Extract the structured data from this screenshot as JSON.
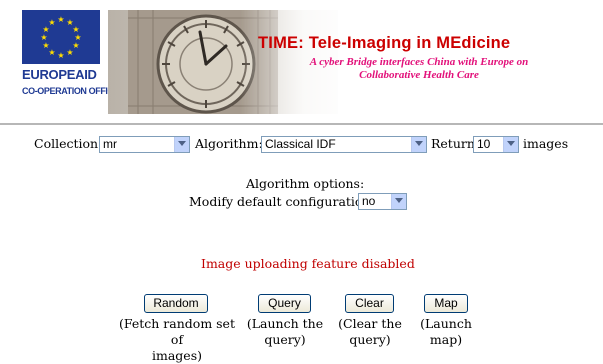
{
  "header": {
    "logo_line1": "EUROPEAID",
    "logo_line2": "CO-OPERATION OFFICE",
    "title": "TIME: Tele-Imaging in MEdicine",
    "subtitle_line1": "A cyber Bridge interfaces China with Europe on",
    "subtitle_line2": "Collaborative Health Care"
  },
  "search": {
    "collection_label": "Collection:",
    "collection_value": "mr",
    "algorithm_label": "Algorithm:",
    "algorithm_value": "Classical IDF",
    "return_label": "Return",
    "return_value": "10",
    "images_label": "images"
  },
  "options": {
    "heading": "Algorithm options:",
    "modify_label": "Modify default configuration:",
    "modify_value": "no"
  },
  "upload_message": "Image uploading feature disabled",
  "actions": [
    {
      "label": "Random",
      "desc_line1": "(Fetch random set of",
      "desc_line2": "images)"
    },
    {
      "label": "Query",
      "desc_line1": "(Launch the",
      "desc_line2": "query)"
    },
    {
      "label": "Clear",
      "desc_line1": "(Clear the",
      "desc_line2": "query)"
    },
    {
      "label": "Map",
      "desc_line1": "(Launch",
      "desc_line2": "map)"
    }
  ],
  "colors": {
    "eu_blue": "#1f3a93",
    "title_red": "#cc0000",
    "subtitle_magenta": "#e2107a",
    "message_red": "#c00000"
  }
}
